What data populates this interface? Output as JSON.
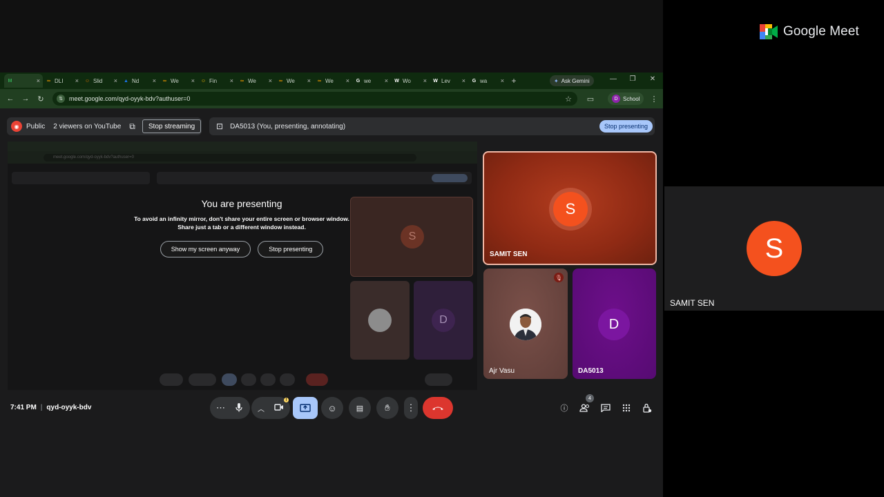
{
  "brand": {
    "name": "Google Meet"
  },
  "speaker_tile": {
    "initial": "S",
    "name": "SAMIT SEN"
  },
  "browser": {
    "tabs": [
      {
        "label": "",
        "icon_color": "#34a853",
        "glyph": "M"
      },
      {
        "label": "DLI",
        "icon_color": "#f29900",
        "glyph": "∞"
      },
      {
        "label": "Slid",
        "icon_color": "#e37400",
        "glyph": "☺"
      },
      {
        "label": "Nd",
        "icon_color": "#1a73e8",
        "glyph": "▲"
      },
      {
        "label": "We",
        "icon_color": "#f29900",
        "glyph": "∞"
      },
      {
        "label": "Fin",
        "icon_color": "#fbbc04",
        "glyph": "☺"
      },
      {
        "label": "We",
        "icon_color": "#f29900",
        "glyph": "∞"
      },
      {
        "label": "We",
        "icon_color": "#f29900",
        "glyph": "∞"
      },
      {
        "label": "We",
        "icon_color": "#f29900",
        "glyph": "∞"
      },
      {
        "label": "we",
        "icon_color": "#ffffff",
        "glyph": "G"
      },
      {
        "label": "Wo",
        "icon_color": "#ffffff",
        "glyph": "W"
      },
      {
        "label": "Lev",
        "icon_color": "#ffffff",
        "glyph": "W"
      },
      {
        "label": "wa",
        "icon_color": "#ffffff",
        "glyph": "G"
      }
    ],
    "ask_gemini": "Ask Gemini",
    "url": "meet.google.com/qyd-oyyk-bdv?authuser=0",
    "profile_initial": "D",
    "profile_label": "School"
  },
  "stream_bar": {
    "visibility": "Public",
    "viewers": "2 viewers on YouTube",
    "stop_streaming": "Stop streaming"
  },
  "present_bar": {
    "title": "DA5013 (You, presenting, annotating)",
    "stop_presenting": "Stop presenting"
  },
  "presenting_overlay": {
    "title": "You are presenting",
    "line1": "To avoid an infinity mirror, don't share your entire screen or browser window.",
    "line2": "Share just a tab or a different window instead.",
    "show_anyway": "Show my screen anyway",
    "stop_presenting": "Stop presenting"
  },
  "participants": [
    {
      "name": "SAMIT SEN",
      "initial": "S"
    },
    {
      "name": "Ajr Vasu",
      "initial": ""
    },
    {
      "name": "DA5013",
      "initial": "D"
    }
  ],
  "footer": {
    "time": "7:41 PM",
    "separator": "|",
    "meeting_code": "qyd-oyyk-bdv",
    "people_count": "4"
  },
  "colors": {
    "accent_blue": "#a8c7fa",
    "end_call_red": "#dc362e",
    "avatar_orange": "#f4511e",
    "avatar_purple": "#7b16a0"
  }
}
